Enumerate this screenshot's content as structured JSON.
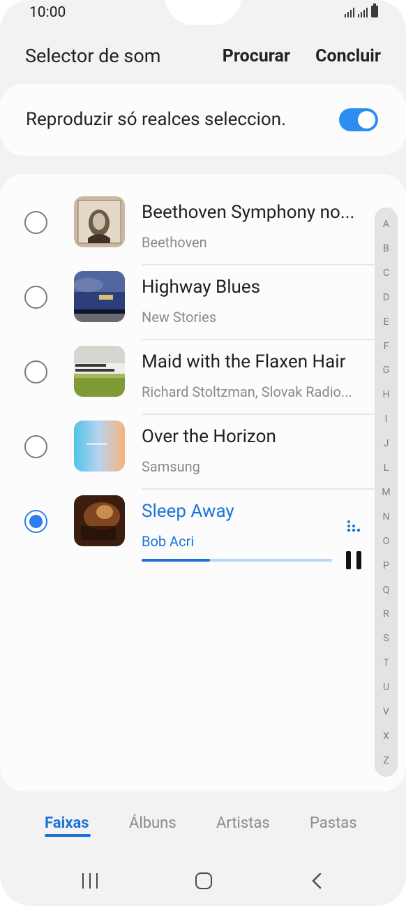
{
  "status": {
    "time": "10:00"
  },
  "header": {
    "title": "Selector de som",
    "search_label": "Procurar",
    "done_label": "Concluir"
  },
  "toggle": {
    "label": "Reproduzir só realces seleccion.",
    "on": true
  },
  "tracks": [
    {
      "title": "Beethoven Symphony no...",
      "artist": "Beethoven",
      "selected": false,
      "art": "beethoven-album-art"
    },
    {
      "title": "Highway Blues",
      "artist": "New Stories",
      "selected": false,
      "art": "highway-blues-album-art"
    },
    {
      "title": "Maid with the Flaxen Hair",
      "artist": "Richard Stoltzman, Slovak Radio...",
      "selected": false,
      "art": "stoltzman-album-art"
    },
    {
      "title": "Over the Horizon",
      "artist": "Samsung",
      "selected": false,
      "art": "over-the-horizon-album-art"
    },
    {
      "title": "Sleep Away",
      "artist": "Bob Acri",
      "selected": true,
      "art": "sleep-away-album-art",
      "progress": 0.36
    }
  ],
  "index": [
    "A",
    "B",
    "C",
    "D",
    "E",
    "F",
    "G",
    "H",
    "I",
    "J",
    "L",
    "M",
    "N",
    "O",
    "P",
    "Q",
    "R",
    "S",
    "T",
    "U",
    "V",
    "X",
    "Z"
  ],
  "tabs": [
    {
      "label": "Faixas",
      "active": true
    },
    {
      "label": "Álbuns",
      "active": false
    },
    {
      "label": "Artistas",
      "active": false
    },
    {
      "label": "Pastas",
      "active": false
    }
  ],
  "colors": {
    "accent": "#1a74d8",
    "switch": "#2e8ef0",
    "background": "#f2f2f2"
  },
  "icons": {
    "recents": "recents-icon",
    "home": "home-icon",
    "back": "back-icon",
    "pause": "pause-icon",
    "equalizer": "equalizer-icon"
  }
}
